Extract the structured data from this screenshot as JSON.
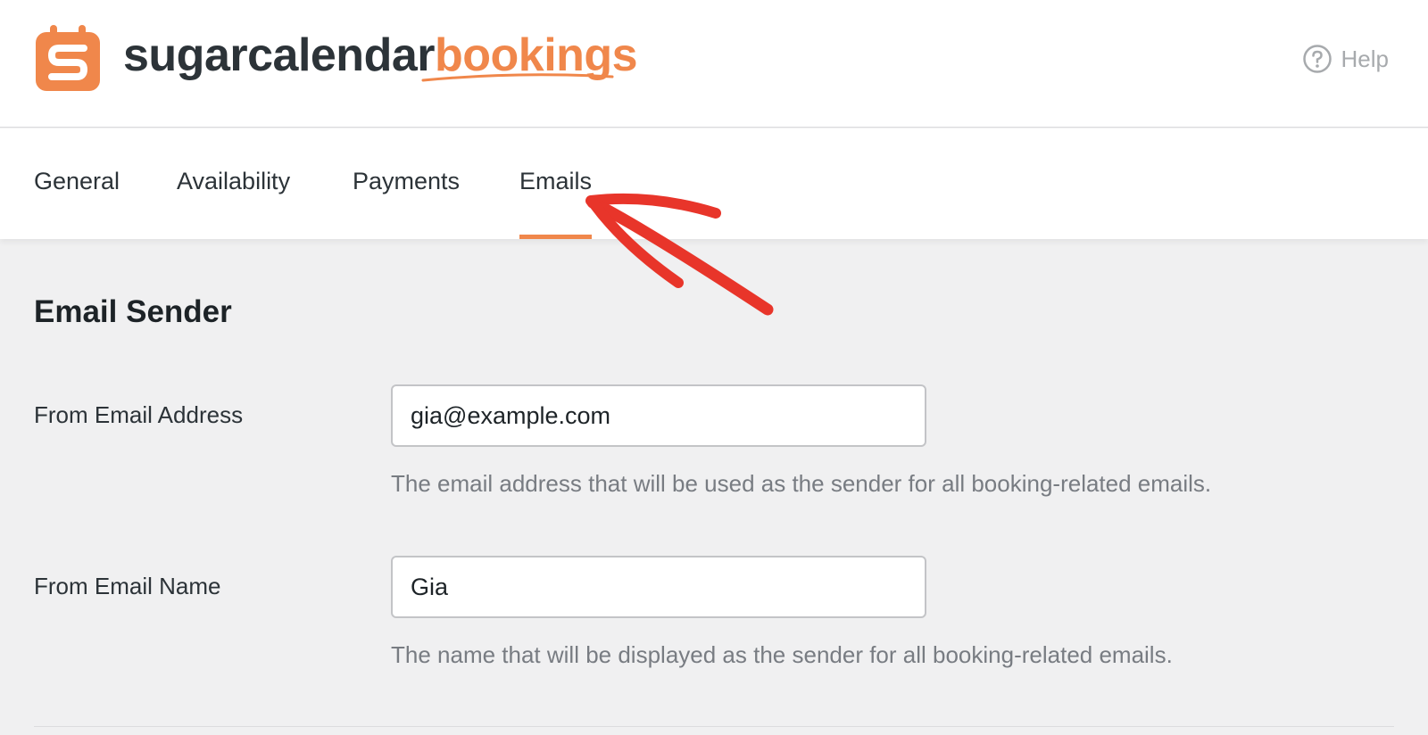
{
  "brand": {
    "name_dark": "sugarcalendar",
    "name_accent": "bookings",
    "accent_color": "#f0874b"
  },
  "header": {
    "help_label": "Help",
    "help_icon": "question-circle-icon"
  },
  "tabs": [
    {
      "label": "General",
      "active": false
    },
    {
      "label": "Availability",
      "active": false
    },
    {
      "label": "Payments",
      "active": false
    },
    {
      "label": "Emails",
      "active": true
    }
  ],
  "section": {
    "title": "Email Sender",
    "fields": [
      {
        "label": "From Email Address",
        "value": "gia@example.com",
        "help": "The email address that will be used as the sender for all booking-related emails."
      },
      {
        "label": "From Email Name",
        "value": "Gia",
        "help": "The name that will be displayed as the sender for all booking-related emails."
      }
    ]
  },
  "annotation": {
    "arrow_color": "#e8352a",
    "arrow_icon": "red-arrow-annotation"
  }
}
